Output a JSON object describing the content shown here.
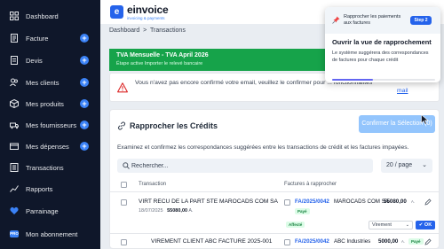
{
  "sidebar": {
    "items": [
      {
        "label": "Dashboard",
        "icon": "dashboard-icon",
        "plus": false
      },
      {
        "label": "Facture",
        "icon": "invoice-icon",
        "plus": true
      },
      {
        "label": "Devis",
        "icon": "quote-icon",
        "plus": true
      },
      {
        "label": "Mes clients",
        "icon": "users-icon",
        "plus": true
      },
      {
        "label": "Mes produits",
        "icon": "box-icon",
        "plus": true
      },
      {
        "label": "Mes fournisseurs",
        "icon": "supplier-icon",
        "plus": true
      },
      {
        "label": "Mes dépenses",
        "icon": "expense-icon",
        "plus": true
      },
      {
        "label": "Transactions",
        "icon": "transactions-icon",
        "plus": false
      },
      {
        "label": "Rapports",
        "icon": "chart-icon",
        "plus": false
      },
      {
        "label": "Parrainage",
        "icon": "heart-icon",
        "plus": false
      },
      {
        "label": "Mon abonnement",
        "icon": "pro-badge-icon",
        "plus": false
      }
    ],
    "pro_badge": "PRO"
  },
  "topbar": {
    "logo_letter": "e",
    "brand": "einvoice",
    "tagline": "invoicing & payments"
  },
  "breadcrumb": {
    "home": "Dashboard",
    "separator": ">",
    "current": "Transactions"
  },
  "banner": {
    "title": "TVA Mensuelle - TVA April 2026",
    "subtitle": "Étape active Importer le relevé bancaire",
    "color": "#16a34a"
  },
  "alert": {
    "text": "Vous n'avez pas encore confirmé votre email, veuillez le confirmer pour ... fonctionnalités",
    "link": "mail"
  },
  "reconcile": {
    "title": "Rapprocher les Crédits",
    "confirm_button": "Confirmer la Sélection (0)",
    "description": "Examinez et confirmez les correspondances suggérées entre les transactions de crédit et les factures impayées.",
    "search_placeholder": "Rechercher...",
    "per_page": "20 / page",
    "columns": [
      "Transaction",
      "Factures à rapprocher"
    ],
    "rows": [
      {
        "transaction": "VIRT RECU DE LA PART STE MAROCADS COM SA",
        "date": "18/07/2025",
        "amount": "55080,00",
        "amount_suffix": "A.",
        "invoice": "FA/2025/0042",
        "client": "MAROCADS COM SA",
        "invoice_amount": "55080,00",
        "ht": "A.",
        "invoice_status": "Payé",
        "match_status": "Affecté",
        "method": "Virement",
        "ok_label": "✔ OK"
      },
      {
        "transaction": "VIREMENT CLIENT ABC FACTURE 2025-001",
        "invoice": "FA/2025/0042",
        "client": "ABC Industries",
        "invoice_amount": "5000,00",
        "ht": "A.",
        "invoice_status": "Payé"
      }
    ]
  },
  "tour_popup": {
    "header": "Rapprocher les paiements aux factures",
    "step": "Step 2",
    "title": "Ouvrir la vue de rapprochement",
    "text": "Le système suggérera des correspondances de factures pour chaque crédit",
    "progress": 0.4
  },
  "colors": {
    "sidebar_bg": "#0f172a",
    "accent": "#2563eb",
    "success": "#16a34a"
  }
}
